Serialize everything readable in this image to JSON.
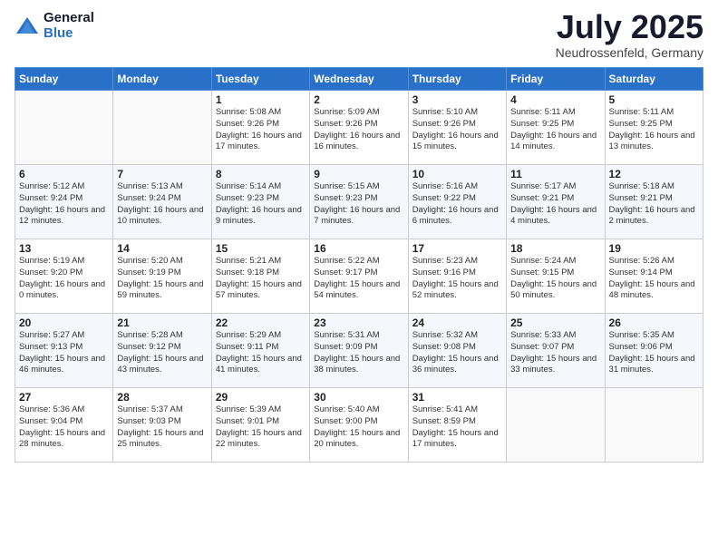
{
  "logo": {
    "general": "General",
    "blue": "Blue"
  },
  "title": {
    "month": "July 2025",
    "location": "Neudrossenfeld, Germany"
  },
  "headers": [
    "Sunday",
    "Monday",
    "Tuesday",
    "Wednesday",
    "Thursday",
    "Friday",
    "Saturday"
  ],
  "weeks": [
    [
      {
        "day": "",
        "info": ""
      },
      {
        "day": "",
        "info": ""
      },
      {
        "day": "1",
        "info": "Sunrise: 5:08 AM\nSunset: 9:26 PM\nDaylight: 16 hours\nand 17 minutes."
      },
      {
        "day": "2",
        "info": "Sunrise: 5:09 AM\nSunset: 9:26 PM\nDaylight: 16 hours\nand 16 minutes."
      },
      {
        "day": "3",
        "info": "Sunrise: 5:10 AM\nSunset: 9:26 PM\nDaylight: 16 hours\nand 15 minutes."
      },
      {
        "day": "4",
        "info": "Sunrise: 5:11 AM\nSunset: 9:25 PM\nDaylight: 16 hours\nand 14 minutes."
      },
      {
        "day": "5",
        "info": "Sunrise: 5:11 AM\nSunset: 9:25 PM\nDaylight: 16 hours\nand 13 minutes."
      }
    ],
    [
      {
        "day": "6",
        "info": "Sunrise: 5:12 AM\nSunset: 9:24 PM\nDaylight: 16 hours\nand 12 minutes."
      },
      {
        "day": "7",
        "info": "Sunrise: 5:13 AM\nSunset: 9:24 PM\nDaylight: 16 hours\nand 10 minutes."
      },
      {
        "day": "8",
        "info": "Sunrise: 5:14 AM\nSunset: 9:23 PM\nDaylight: 16 hours\nand 9 minutes."
      },
      {
        "day": "9",
        "info": "Sunrise: 5:15 AM\nSunset: 9:23 PM\nDaylight: 16 hours\nand 7 minutes."
      },
      {
        "day": "10",
        "info": "Sunrise: 5:16 AM\nSunset: 9:22 PM\nDaylight: 16 hours\nand 6 minutes."
      },
      {
        "day": "11",
        "info": "Sunrise: 5:17 AM\nSunset: 9:21 PM\nDaylight: 16 hours\nand 4 minutes."
      },
      {
        "day": "12",
        "info": "Sunrise: 5:18 AM\nSunset: 9:21 PM\nDaylight: 16 hours\nand 2 minutes."
      }
    ],
    [
      {
        "day": "13",
        "info": "Sunrise: 5:19 AM\nSunset: 9:20 PM\nDaylight: 16 hours\nand 0 minutes."
      },
      {
        "day": "14",
        "info": "Sunrise: 5:20 AM\nSunset: 9:19 PM\nDaylight: 15 hours\nand 59 minutes."
      },
      {
        "day": "15",
        "info": "Sunrise: 5:21 AM\nSunset: 9:18 PM\nDaylight: 15 hours\nand 57 minutes."
      },
      {
        "day": "16",
        "info": "Sunrise: 5:22 AM\nSunset: 9:17 PM\nDaylight: 15 hours\nand 54 minutes."
      },
      {
        "day": "17",
        "info": "Sunrise: 5:23 AM\nSunset: 9:16 PM\nDaylight: 15 hours\nand 52 minutes."
      },
      {
        "day": "18",
        "info": "Sunrise: 5:24 AM\nSunset: 9:15 PM\nDaylight: 15 hours\nand 50 minutes."
      },
      {
        "day": "19",
        "info": "Sunrise: 5:26 AM\nSunset: 9:14 PM\nDaylight: 15 hours\nand 48 minutes."
      }
    ],
    [
      {
        "day": "20",
        "info": "Sunrise: 5:27 AM\nSunset: 9:13 PM\nDaylight: 15 hours\nand 46 minutes."
      },
      {
        "day": "21",
        "info": "Sunrise: 5:28 AM\nSunset: 9:12 PM\nDaylight: 15 hours\nand 43 minutes."
      },
      {
        "day": "22",
        "info": "Sunrise: 5:29 AM\nSunset: 9:11 PM\nDaylight: 15 hours\nand 41 minutes."
      },
      {
        "day": "23",
        "info": "Sunrise: 5:31 AM\nSunset: 9:09 PM\nDaylight: 15 hours\nand 38 minutes."
      },
      {
        "day": "24",
        "info": "Sunrise: 5:32 AM\nSunset: 9:08 PM\nDaylight: 15 hours\nand 36 minutes."
      },
      {
        "day": "25",
        "info": "Sunrise: 5:33 AM\nSunset: 9:07 PM\nDaylight: 15 hours\nand 33 minutes."
      },
      {
        "day": "26",
        "info": "Sunrise: 5:35 AM\nSunset: 9:06 PM\nDaylight: 15 hours\nand 31 minutes."
      }
    ],
    [
      {
        "day": "27",
        "info": "Sunrise: 5:36 AM\nSunset: 9:04 PM\nDaylight: 15 hours\nand 28 minutes."
      },
      {
        "day": "28",
        "info": "Sunrise: 5:37 AM\nSunset: 9:03 PM\nDaylight: 15 hours\nand 25 minutes."
      },
      {
        "day": "29",
        "info": "Sunrise: 5:39 AM\nSunset: 9:01 PM\nDaylight: 15 hours\nand 22 minutes."
      },
      {
        "day": "30",
        "info": "Sunrise: 5:40 AM\nSunset: 9:00 PM\nDaylight: 15 hours\nand 20 minutes."
      },
      {
        "day": "31",
        "info": "Sunrise: 5:41 AM\nSunset: 8:59 PM\nDaylight: 15 hours\nand 17 minutes."
      },
      {
        "day": "",
        "info": ""
      },
      {
        "day": "",
        "info": ""
      }
    ]
  ]
}
